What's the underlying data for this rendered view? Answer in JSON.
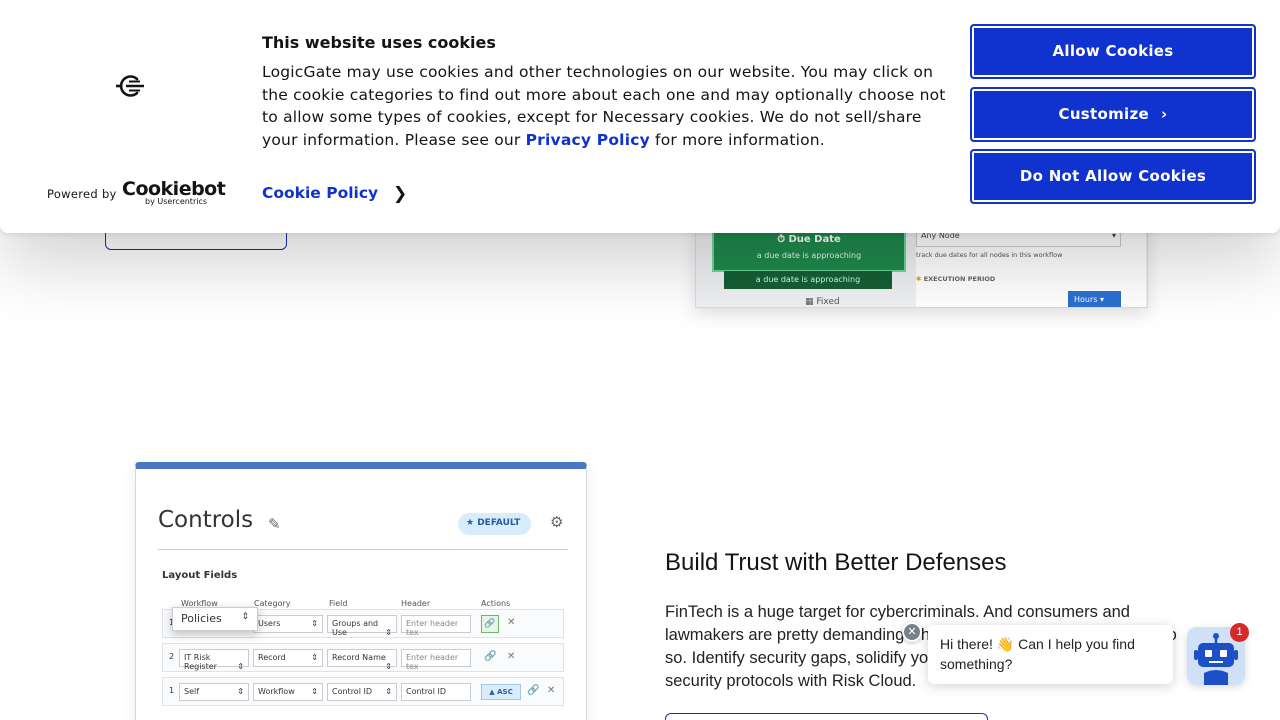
{
  "cookie_banner": {
    "title": "This website uses cookies",
    "text_before_link": "LogicGate may use cookies and other technologies on our website. You may click on the cookie categories to find out more about each one and may optionally choose not to allow some types of cookies, except for Necessary cookies.  We do not sell/share your information. Please see our ",
    "privacy_link": "Privacy Policy",
    "text_after_link": " for more information.",
    "cookie_policy_link": "Cookie Policy",
    "powered_by": "Powered by",
    "cookiebot_name": "Cookiebot",
    "cookiebot_sub": "by Usercentrics",
    "buttons": {
      "allow": "Allow Cookies",
      "customize": "Customize",
      "deny": "Do Not Allow Cookies"
    },
    "accent_color": "#1032cf"
  },
  "workflow_screenshot": {
    "due_title": "Due Date",
    "due_sub": "a due date is approaching",
    "due_sub2": "a due date is approaching",
    "fixed": "Fixed",
    "node_select": "Any Node",
    "node_note": "track due dates for all nodes in this workflow",
    "execution_label": "EXECUTION PERIOD",
    "hours": "Hours"
  },
  "controls_screenshot": {
    "title": "Controls",
    "badge": "DEFAULT",
    "layout_fields": "Layout Fields",
    "headers": [
      "Workflow",
      "Category",
      "Field",
      "Header",
      "Actions"
    ],
    "popup_value": "Policies",
    "rows": [
      {
        "num": "1",
        "workflow": "",
        "category": "Users",
        "field": "Groups and Use",
        "header": "Enter header tex"
      },
      {
        "num": "2",
        "workflow": "IT Risk Register",
        "category": "Record",
        "field": "Record Name",
        "header": "Enter header tex"
      },
      {
        "num": "1",
        "workflow": "Self",
        "category": "Workflow",
        "field": "Control ID",
        "header": "Control ID",
        "sort": "ASC"
      }
    ]
  },
  "section": {
    "heading": "Build Trust with Better Defenses",
    "body": "FinTech is a huge target for cybercriminals. And consumers and lawmakers are pretty demanding when it comes to protecting data. Do so. Identify security gaps, solidify your defenses, and streamline security protocols with Risk Cloud."
  },
  "chat": {
    "greeting": "Hi there! 👋 Can I help you find something?",
    "badge_count": "1",
    "close_icon": "close-icon",
    "launcher_icon": "robot-icon"
  }
}
